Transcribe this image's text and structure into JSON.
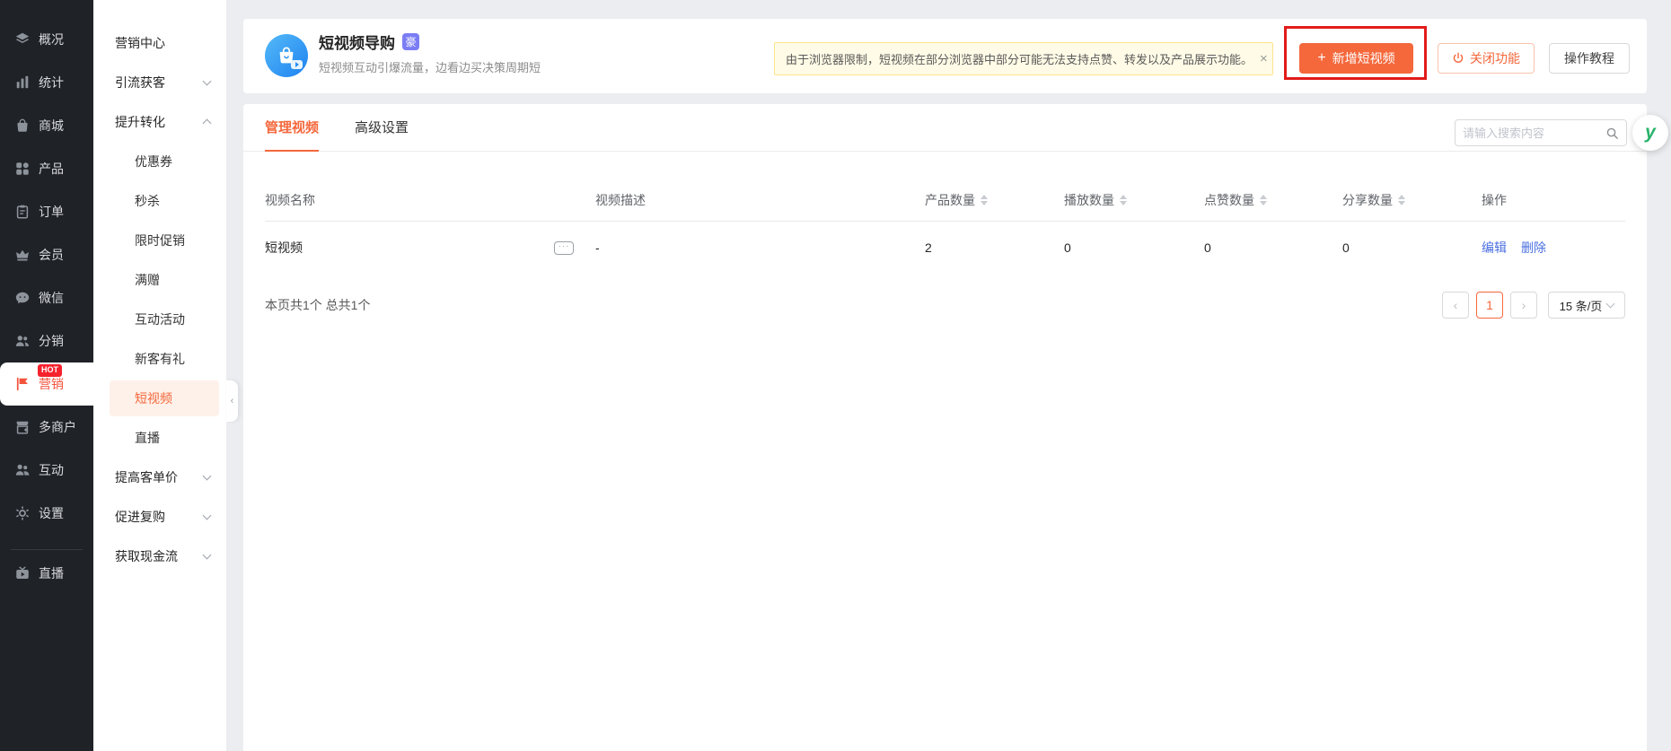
{
  "colors": {
    "accent": "#F4683C",
    "title_badge": "#7B7DF5",
    "alert_bg": "#FFFBE6",
    "hot": "#F5222D",
    "link": "#4A6FE0",
    "annotation": "#E21B1B"
  },
  "sidebar": {
    "items": [
      "概况",
      "统计",
      "商城",
      "产品",
      "订单",
      "会员",
      "微信",
      "分销",
      "营销",
      "多商户",
      "互动",
      "设置",
      "直播"
    ],
    "hot_badge": "HOT"
  },
  "submenu": {
    "rows": [
      "营销中心",
      "引流获客",
      "提升转化",
      "优惠券",
      "秒杀",
      "限时促销",
      "满赠",
      "互动活动",
      "新客有礼",
      "短视频",
      "直播",
      "提高客单价",
      "促进复购",
      "获取现金流"
    ]
  },
  "collapse_glyph": "‹",
  "header": {
    "title": "短视频导购",
    "badge": "豪",
    "subtitle": "短视频互动引爆流量，边看边买决策周期短",
    "alert_text": "由于浏览器限制，短视频在部分浏览器中部分可能无法支持点赞、转发以及产品展示功能。",
    "alert_close": "×",
    "add_plus": "+",
    "add_label": "新增短视频",
    "disable_label": "关闭功能",
    "tutorial_label": "操作教程"
  },
  "content": {
    "tabs": [
      "管理视频",
      "高级设置"
    ],
    "search_placeholder": "请输入搜索内容"
  },
  "table": {
    "headers": [
      "视频名称",
      "视频描述",
      "产品数量",
      "播放数量",
      "点赞数量",
      "分享数量",
      "操作"
    ],
    "rows": [
      {
        "name": "短视频",
        "name_icon": "···",
        "desc": "-",
        "products": "2",
        "plays": "0",
        "likes": "0",
        "shares": "0",
        "edit": "编辑",
        "delete": "删除"
      }
    ]
  },
  "pagination": {
    "summary": "本页共1个 总共1个",
    "prev": "‹",
    "current": "1",
    "next": "›",
    "page_size": "15 条/页"
  },
  "float_widget": {
    "logo": "y"
  }
}
